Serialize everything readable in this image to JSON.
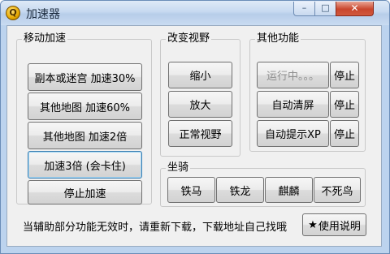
{
  "window": {
    "title": "加速器",
    "app_icon_glyph": "Q",
    "controls": {
      "minimize": "–",
      "maximize": "□",
      "close": "✕"
    }
  },
  "groups": {
    "move_speed": {
      "label": "移动加速",
      "buttons": [
        "副本或迷宫 加速30%",
        "其他地图 加速60%",
        "其他地图 加速2倍",
        "加速3倍 (会卡住)",
        "停止加速"
      ]
    },
    "view": {
      "label": "改变视野",
      "buttons": [
        "缩小",
        "放大",
        "正常视野"
      ]
    },
    "other": {
      "label": "其他功能",
      "rows": [
        {
          "action": "运行中。。。",
          "stop": "停止"
        },
        {
          "action": "自动清屏",
          "stop": "停止"
        },
        {
          "action": "自动提示XP",
          "stop": "停止"
        }
      ]
    },
    "mount": {
      "label": "坐骑",
      "buttons": [
        "铁马",
        "铁龙",
        "麒麟",
        "不死鸟"
      ]
    }
  },
  "footer": {
    "notice": "当辅助部分功能无效时，请重新下载，下载地址自己找哦",
    "help_icon": "★",
    "help_label": "使用说明"
  }
}
